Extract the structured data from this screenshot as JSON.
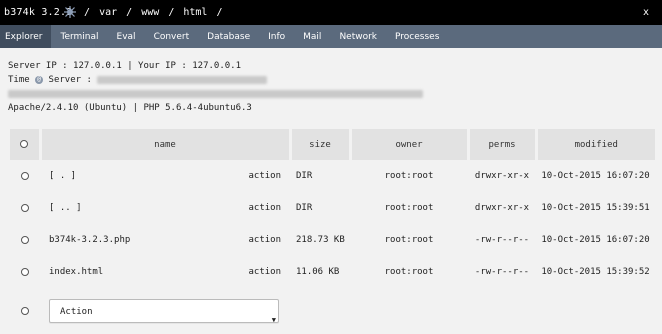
{
  "header": {
    "title": "b374k 3.2.3",
    "path": [
      "/",
      "var",
      "/",
      "www",
      "/",
      "html",
      "/"
    ],
    "close": "x"
  },
  "nav": [
    "Explorer",
    "Terminal",
    "Eval",
    "Convert",
    "Database",
    "Info",
    "Mail",
    "Network",
    "Processes"
  ],
  "info": {
    "line1": "Server IP : 127.0.0.1 | Your IP : 127.0.0.1",
    "time_label": "Time",
    "server_label": "Server :",
    "line4": "Apache/2.4.10 (Ubuntu) | PHP 5.6.4-4ubuntu6.3"
  },
  "table": {
    "headers": [
      "name",
      "size",
      "owner",
      "perms",
      "modified"
    ],
    "rows": [
      {
        "name": "[ . ]",
        "action": "action",
        "size": "DIR",
        "owner": "root:root",
        "perms": "drwxr-xr-x",
        "modified": "10-Oct-2015 16:07:20"
      },
      {
        "name": "[ .. ]",
        "action": "action",
        "size": "DIR",
        "owner": "root:root",
        "perms": "drwxr-xr-x",
        "modified": "10-Oct-2015 15:39:51"
      },
      {
        "name": "b374k-3.2.3.php",
        "action": "action",
        "size": "218.73 KB",
        "owner": "root:root",
        "perms": "-rw-r--r--",
        "modified": "10-Oct-2015 16:07:20"
      },
      {
        "name": "index.html",
        "action": "action",
        "size": "11.06 KB",
        "owner": "root:root",
        "perms": "-rw-r--r--",
        "modified": "10-Oct-2015 15:39:52"
      }
    ],
    "action_select": "Action"
  }
}
